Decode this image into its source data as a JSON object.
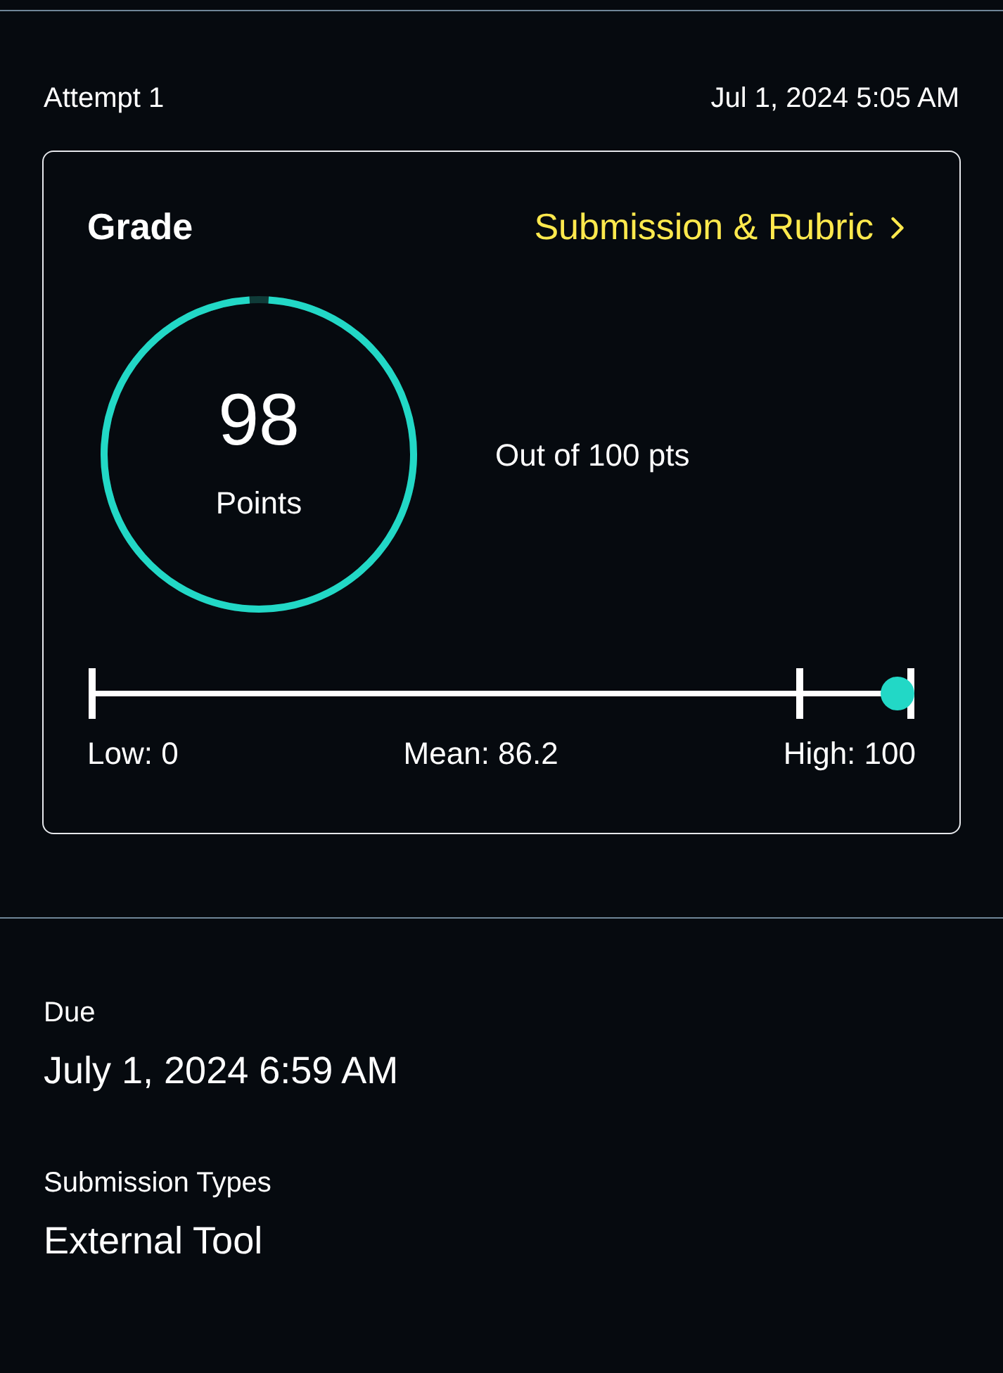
{
  "attempt": {
    "label": "Attempt 1",
    "date": "Jul 1, 2024 5:05 AM"
  },
  "grade": {
    "title": "Grade",
    "link": "Submission & Rubric",
    "ring": {
      "level": 0.98
    },
    "score": "98",
    "score_label": "Points",
    "out_of": "Out of 100 pts",
    "range": {
      "markers": [
        {
          "kind": "mean",
          "level": 0.862
        },
        {
          "kind": "score",
          "level": 0.98
        }
      ],
      "labels": [
        "Low: 0",
        "Mean: 86.2",
        "High: 100"
      ]
    }
  },
  "details": [
    {
      "label": "Due",
      "value": "July 1, 2024 6:59 AM"
    },
    {
      "label": "Submission Types",
      "value": "External Tool"
    }
  ]
}
